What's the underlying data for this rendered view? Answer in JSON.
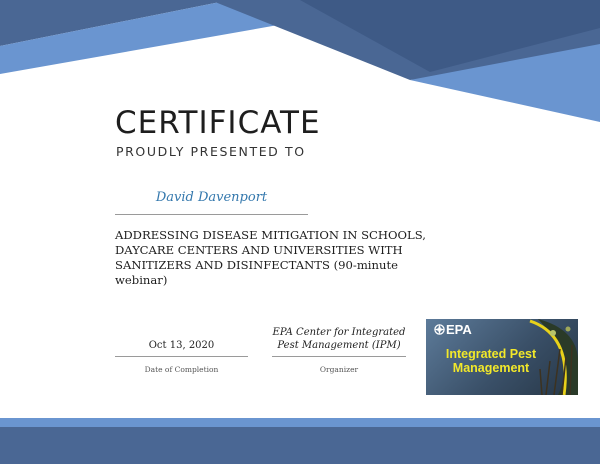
{
  "certificate": {
    "title": "CERTIFICATE",
    "subtitle": "PROUDLY PRESENTED TO",
    "recipient": "David Davenport",
    "course": "ADDRESSING DISEASE MITIGATION IN SCHOOLS, DAYCARE CENTERS AND UNIVERSITIES WITH SANITIZERS AND DISINFECTANTS (90-minute webinar)",
    "date_value": "Oct 13, 2020",
    "date_label": "Date of Completion",
    "organizer_line1": "EPA Center for Integrated",
    "organizer_line2": "Pest Management (IPM)",
    "organizer_label": "Organizer"
  },
  "logo": {
    "brand": "EPA",
    "line1": "Integrated Pest",
    "line2": "Management"
  },
  "colors": {
    "band_light": "#6a95d0",
    "band_dark": "#4a6794",
    "recipient": "#3478ad",
    "logo_text": "#f2e82a"
  }
}
